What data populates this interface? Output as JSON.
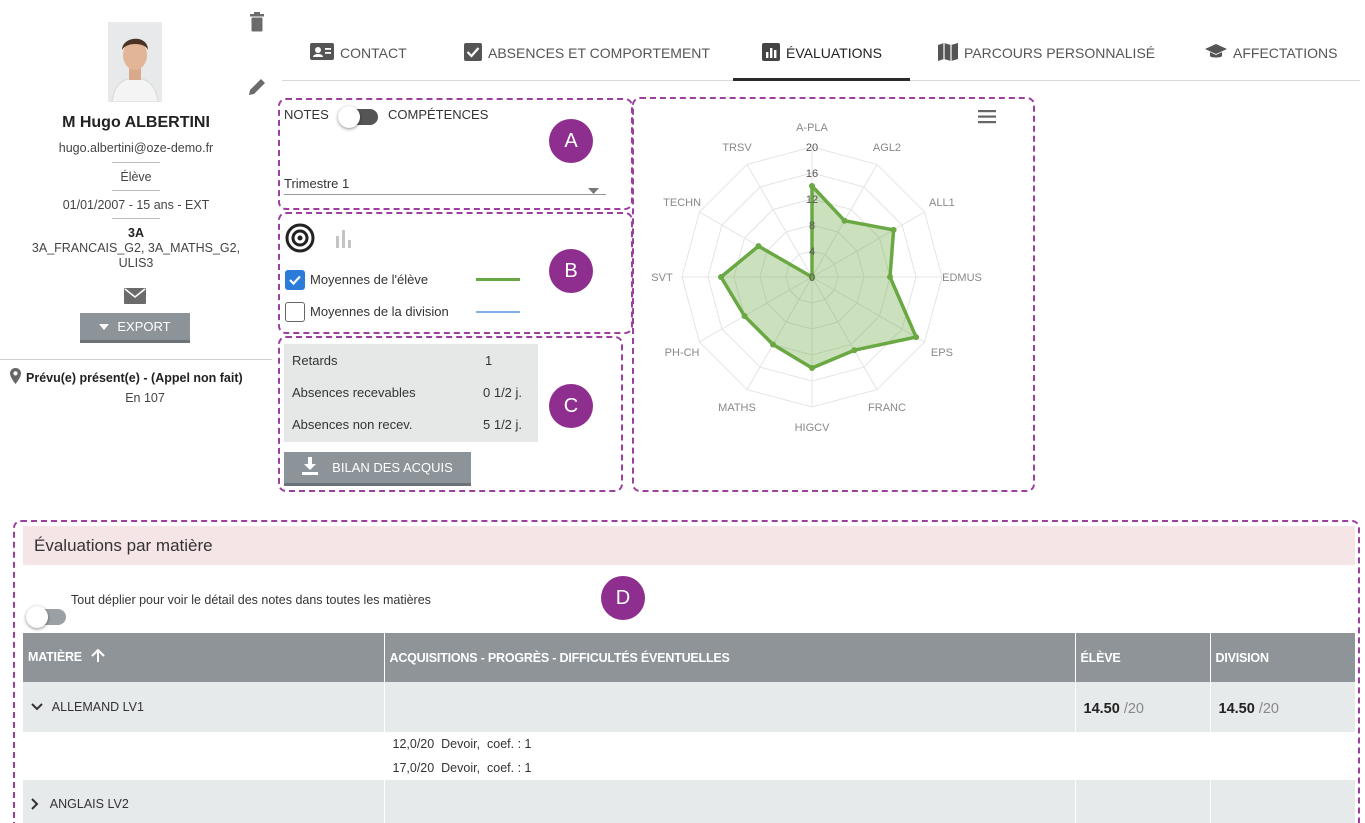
{
  "profile": {
    "name": "M Hugo ALBERTINI",
    "email": "hugo.albertini@oze-demo.fr",
    "role": "Élève",
    "birth": "01/01/2007 - 15 ans - EXT",
    "class": "3A",
    "groups_line1": "3A_FRANCAIS_G2, 3A_MATHS_G2,",
    "groups_line2": "ULIS3",
    "export_label": "EXPORT",
    "status": "Prévu(e) présent(e) - (Appel non fait)",
    "room": "En 107"
  },
  "tabs": [
    {
      "label": "CONTACT",
      "icon": "contact-card-icon",
      "active": false
    },
    {
      "label": "ABSENCES ET COMPORTEMENT",
      "icon": "checkbox-icon",
      "active": false
    },
    {
      "label": "ÉVALUATIONS",
      "icon": "bar-chart-icon",
      "active": true
    },
    {
      "label": "PARCOURS PERSONNALISÉ",
      "icon": "map-icon",
      "active": false
    },
    {
      "label": "AFFECTATIONS",
      "icon": "graduation-cap-icon",
      "active": false
    }
  ],
  "boxA": {
    "notes_label": "NOTES",
    "competences_label": "COMPÉTENCES",
    "period": "Trimestre 1",
    "marker": "A"
  },
  "boxB": {
    "student_avg_label": "Moyennes de l'élève",
    "division_avg_label": "Moyennes de la division",
    "student_checked": true,
    "division_checked": false,
    "student_color": "#6aa843",
    "division_color": "#7fb0e8",
    "marker": "B"
  },
  "boxC": {
    "rows": [
      {
        "label": "Retards",
        "value": "1"
      },
      {
        "label": "Absences recevables",
        "value": "0 1/2 j."
      },
      {
        "label": "Absences non recev.",
        "value": "5 1/2 j."
      }
    ],
    "bilan_label": "BILAN DES ACQUIS",
    "marker": "C"
  },
  "chart_data": {
    "type": "radar",
    "categories": [
      "A-PLA",
      "AGL2",
      "ALL1",
      "EDMUS",
      "EPS",
      "FRANC",
      "HIGCV",
      "MATHS",
      "PH-CH",
      "SVT",
      "TECHN",
      "TRSV"
    ],
    "series": [
      {
        "values": [
          14,
          10,
          14.5,
          12,
          18.5,
          13,
          14,
          12,
          12,
          14,
          9.5,
          0
        ],
        "color": "#6aa843"
      }
    ],
    "rlim": [
      0,
      20
    ],
    "ticks": [
      "0",
      "4",
      "8",
      "12",
      "16",
      "20"
    ]
  },
  "boxD": {
    "title": "Évaluations par matière",
    "toggle_label": "Tout déplier pour voir le détail des notes dans toutes les matières",
    "marker": "D",
    "columns": [
      "MATIÈRE",
      "ACQUISITIONS - PROGRÈS - DIFFICULTÉS ÉVENTUELLES",
      "ÉLÈVE",
      "DIVISION"
    ],
    "subjects": [
      {
        "name": "ALLEMAND LV1",
        "expanded": true,
        "eleve": "14.50",
        "division": "14.50",
        "denominator": "/20",
        "details": [
          "12,0/20  Devoir,  coef. : 1",
          "17,0/20  Devoir,  coef. : 1"
        ]
      },
      {
        "name": "ANGLAIS LV2",
        "expanded": false,
        "eleve": "",
        "division": "",
        "denominator": "",
        "details": []
      }
    ]
  }
}
